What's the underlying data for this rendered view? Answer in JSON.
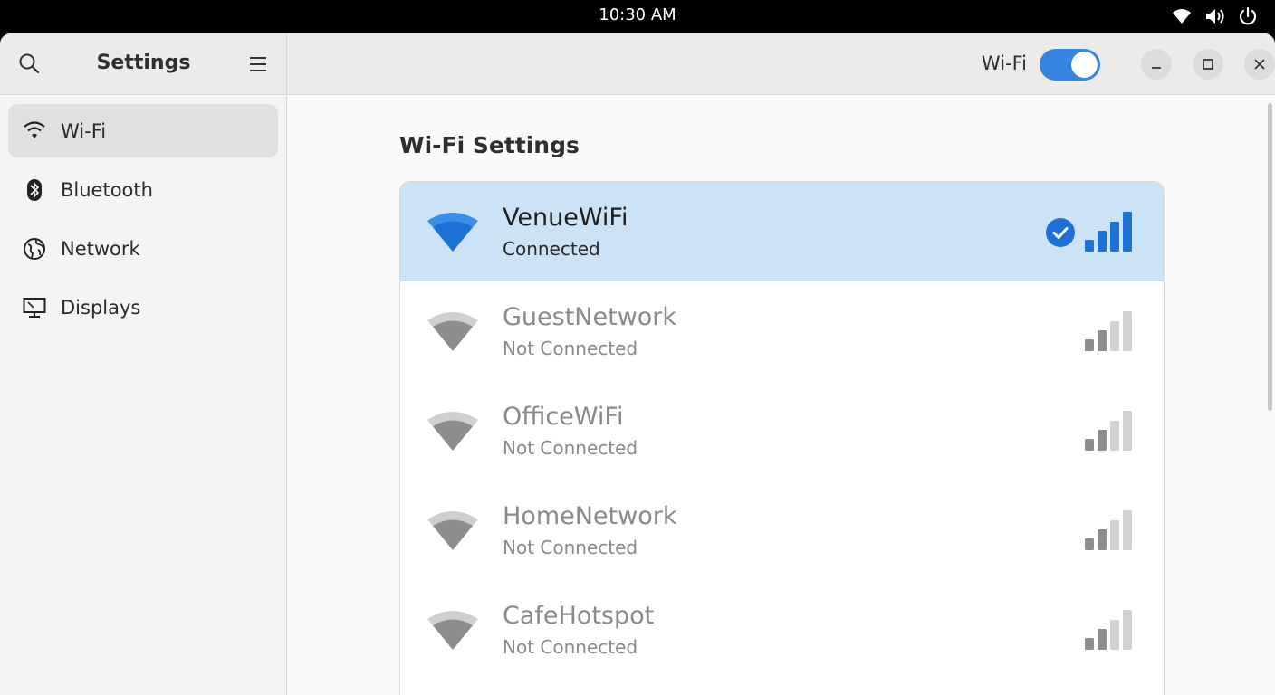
{
  "topbar": {
    "clock": "10:30 AM",
    "icons": [
      "wifi-icon",
      "volume-icon",
      "power-icon"
    ]
  },
  "window": {
    "sidebar_title": "Settings",
    "header_toggle_label": "Wi-Fi",
    "wifi_enabled": true
  },
  "sidebar": {
    "items": [
      {
        "label": "Wi-Fi",
        "icon": "wifi-icon",
        "active": true
      },
      {
        "label": "Bluetooth",
        "icon": "bluetooth-icon",
        "active": false
      },
      {
        "label": "Network",
        "icon": "globe-icon",
        "active": false
      },
      {
        "label": "Displays",
        "icon": "monitor-icon",
        "active": false
      }
    ]
  },
  "main": {
    "section_title": "Wi-Fi Settings",
    "networks": [
      {
        "name": "VenueWiFi",
        "status": "Connected",
        "connected": true
      },
      {
        "name": "GuestNetwork",
        "status": "Not Connected",
        "connected": false
      },
      {
        "name": "OfficeWiFi",
        "status": "Not Connected",
        "connected": false
      },
      {
        "name": "HomeNetwork",
        "status": "Not Connected",
        "connected": false
      },
      {
        "name": "CafeHotspot",
        "status": "Not Connected",
        "connected": false
      }
    ]
  },
  "colors": {
    "accent": "#3584e4",
    "connected_row": "#cce3f7",
    "signal_active": "#1c71d8",
    "signal_inactive": "#8d8d8d"
  }
}
